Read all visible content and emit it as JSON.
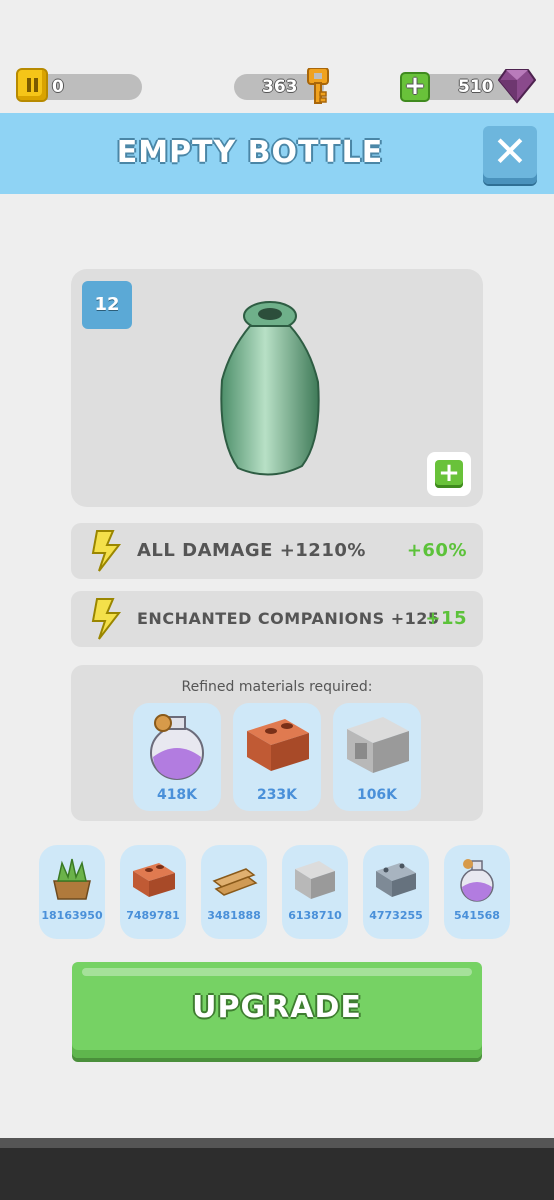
{
  "currency": {
    "coins": "0",
    "keys": "363",
    "gems": "510",
    "colors": {
      "coin": "#f5c518",
      "key": "#f0a21e",
      "gem": "#8a4a8c",
      "add": "#69c23a"
    }
  },
  "header": {
    "title": "EMPTY BOTTLE",
    "close_icon": "close-icon",
    "color": "#8fd3f4"
  },
  "item": {
    "level": "12",
    "image_icon": "empty-bottle-icon",
    "add_icon": "plus-icon"
  },
  "stats": [
    {
      "label": "ALL DAMAGE +1210%",
      "bonus": "+60%",
      "icon": "lightning-icon"
    },
    {
      "label": "ENCHANTED COMPANIONS +125",
      "bonus": "+15",
      "icon": "lightning-icon"
    }
  ],
  "materials": {
    "title": "Refined materials required:",
    "required": [
      {
        "icon": "purple-potion-icon",
        "amount": "418K"
      },
      {
        "icon": "brick-icon",
        "amount": "233K"
      },
      {
        "icon": "stone-block-icon",
        "amount": "106K"
      }
    ]
  },
  "inventory": [
    {
      "icon": "plant-crate-icon",
      "amount": "18163950"
    },
    {
      "icon": "brick-icon",
      "amount": "7489781"
    },
    {
      "icon": "wood-planks-icon",
      "amount": "3481888"
    },
    {
      "icon": "stone-block-icon",
      "amount": "6138710"
    },
    {
      "icon": "metal-plate-icon",
      "amount": "4773255"
    },
    {
      "icon": "purple-potion-icon",
      "amount": "541568"
    }
  ],
  "upgrade": {
    "label": "UPGRADE",
    "color": "#76d264"
  }
}
